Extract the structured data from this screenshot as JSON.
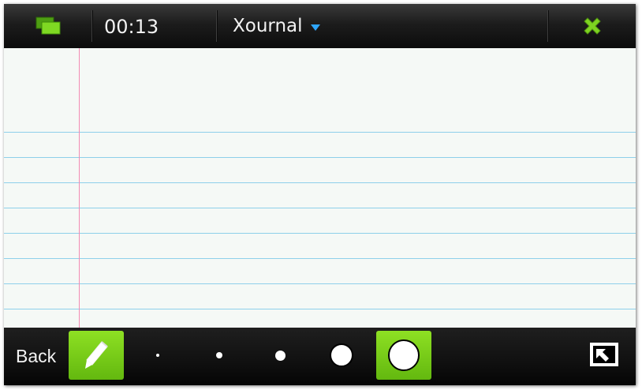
{
  "topbar": {
    "clock": "00:13",
    "app_title": "Xournal",
    "icons": {
      "task_switcher": "task-switcher-icon",
      "dropdown": "chevron-down-icon",
      "close": "close-icon"
    },
    "colors": {
      "task_switcher": "#6fcf1b",
      "close": "#7ed321",
      "caret": "#2ea6ff"
    }
  },
  "paper": {
    "colors": {
      "background": "#f5f9f6",
      "rule": "#8ed0ea",
      "margin": "#f28bb3"
    }
  },
  "toolbar": {
    "back_label": "Back",
    "pen_tool": "pencil-icon",
    "pen_sizes": [
      "extra-fine",
      "fine",
      "medium",
      "thick",
      "extra-thick"
    ],
    "selected_pen_size": "extra-thick",
    "fullscreen": "fullscreen-icon",
    "colors": {
      "active": "#7ccf1c"
    }
  }
}
